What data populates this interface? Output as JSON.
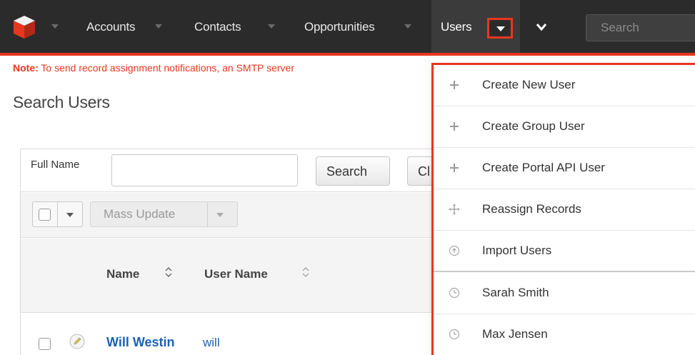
{
  "nav": {
    "items": [
      "Accounts",
      "Contacts",
      "Opportunities"
    ],
    "active": "Users",
    "search_placeholder": "Search",
    "accent": "#e8371f",
    "bg": "#2b2b2b"
  },
  "note": {
    "prefix": "Note:",
    "text": " To send record assignment notifications, an SMTP server"
  },
  "page_title": "Search Users",
  "filter": {
    "full_name_label": "Full Name",
    "full_name_value": "",
    "search_label": "Search",
    "clear_label": "Cl"
  },
  "actions": {
    "mass_update_label": "Mass Update"
  },
  "table": {
    "columns": [
      "Name",
      "User Name"
    ],
    "rows": [
      {
        "name": "Will Westin",
        "user_name": "will"
      }
    ]
  },
  "dropdown": {
    "items": [
      {
        "label": "Create New User",
        "icon": "plus-icon"
      },
      {
        "label": "Create Group User",
        "icon": "plus-icon"
      },
      {
        "label": "Create Portal API User",
        "icon": "plus-icon"
      },
      {
        "label": "Reassign Records",
        "icon": "move-icon"
      },
      {
        "label": "Import Users",
        "icon": "upload-icon"
      },
      {
        "label": "Sarah Smith",
        "icon": "clock-icon"
      },
      {
        "label": "Max Jensen",
        "icon": "clock-icon"
      }
    ]
  }
}
